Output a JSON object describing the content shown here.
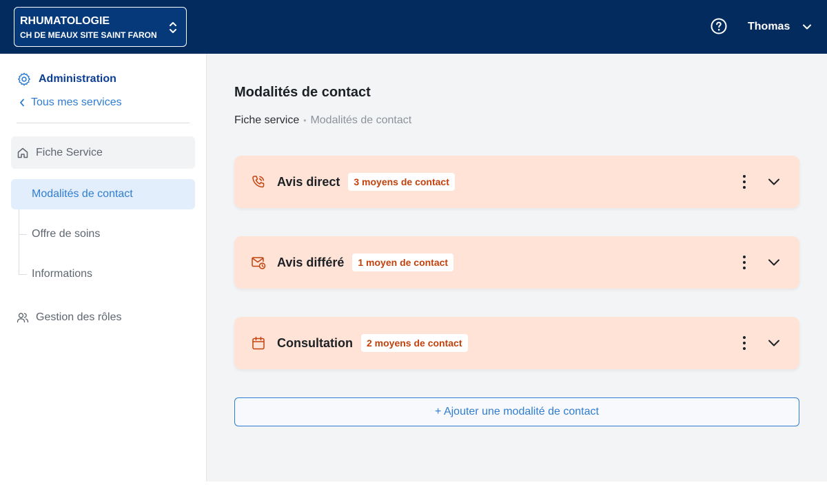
{
  "header": {
    "service_name": "RHUMATOLOGIE",
    "service_site": "CH DE MEAUX SITE SAINT FARON",
    "user_name": "Thomas"
  },
  "sidebar": {
    "section_title": "Administration",
    "back_link": "Tous mes services",
    "fiche_service": "Fiche Service",
    "sub_items": [
      {
        "label": "Modalités de contact",
        "active": true
      },
      {
        "label": "Offre de soins",
        "active": false
      },
      {
        "label": "Informations",
        "active": false
      }
    ],
    "roles": "Gestion des rôles"
  },
  "main": {
    "title": "Modalités de contact",
    "breadcrumb": {
      "parent": "Fiche service",
      "separator": "•",
      "current": "Modalités de contact"
    },
    "cards": [
      {
        "title": "Avis direct",
        "badge": "3 moyens de contact",
        "icon": "phone-call-icon"
      },
      {
        "title": "Avis différé",
        "badge": "1 moyen de contact",
        "icon": "mail-clock-icon"
      },
      {
        "title": "Consultation",
        "badge": "2 moyens de contact",
        "icon": "calendar-icon"
      }
    ],
    "add_button": "+ Ajouter une modalité de contact"
  },
  "colors": {
    "header_bg": "#032b5e",
    "accent_blue": "#2f7dd1",
    "card_bg": "#fee3d6",
    "card_accent": "#c2410c"
  }
}
